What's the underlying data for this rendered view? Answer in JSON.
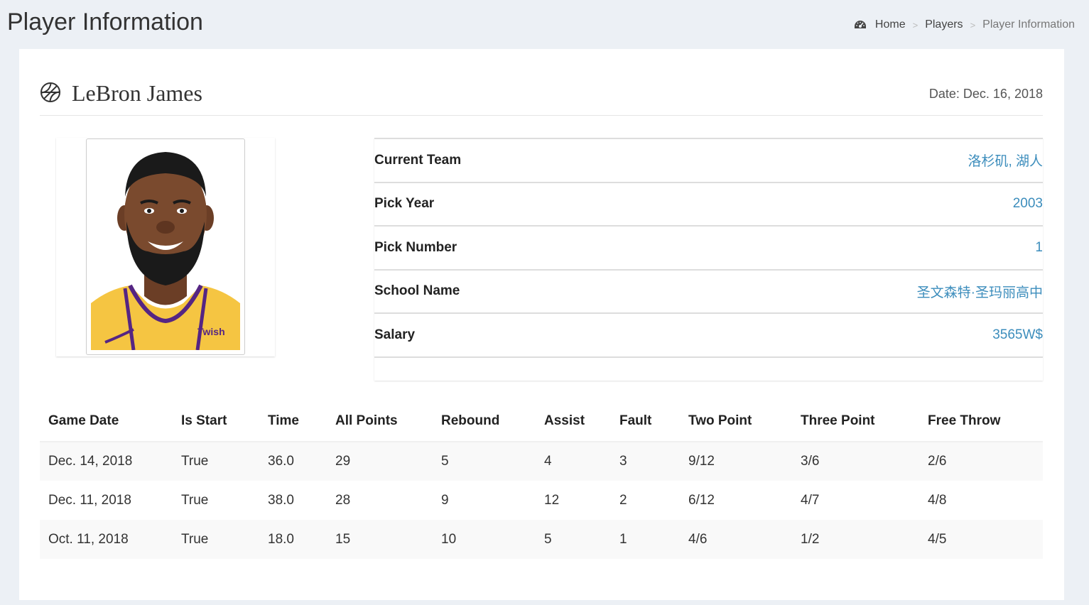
{
  "page": {
    "title": "Player Information"
  },
  "breadcrumb": {
    "home_icon": "dashboard-icon",
    "home": "Home",
    "players": "Players",
    "current": "Player Information",
    "separator": ">"
  },
  "player": {
    "icon": "basketball-icon",
    "name": "LeBron James",
    "date": "Date: Dec. 16, 2018"
  },
  "info": [
    {
      "label": "Current Team",
      "value": "洛杉矶, 湖人"
    },
    {
      "label": "Pick Year",
      "value": "2003"
    },
    {
      "label": "Pick Number",
      "value": "1"
    },
    {
      "label": "School Name",
      "value": "圣文森特·圣玛丽高中"
    },
    {
      "label": "Salary",
      "value": "3565W$"
    }
  ],
  "games": {
    "columns": [
      "Game Date",
      "Is Start",
      "Time",
      "All Points",
      "Rebound",
      "Assist",
      "Fault",
      "Two Point",
      "Three Point",
      "Free Throw"
    ],
    "rows": [
      [
        "Dec. 14, 2018",
        "True",
        "36.0",
        "29",
        "5",
        "4",
        "3",
        "9/12",
        "3/6",
        "2/6"
      ],
      [
        "Dec. 11, 2018",
        "True",
        "38.0",
        "28",
        "9",
        "12",
        "2",
        "6/12",
        "4/7",
        "4/8"
      ],
      [
        "Oct. 11, 2018",
        "True",
        "18.0",
        "15",
        "10",
        "5",
        "1",
        "4/6",
        "1/2",
        "4/5"
      ]
    ]
  },
  "colors": {
    "background": "#ecf0f5",
    "link": "#3c8dbc",
    "jersey": "#f5c542",
    "jersey_trim": "#552583"
  }
}
